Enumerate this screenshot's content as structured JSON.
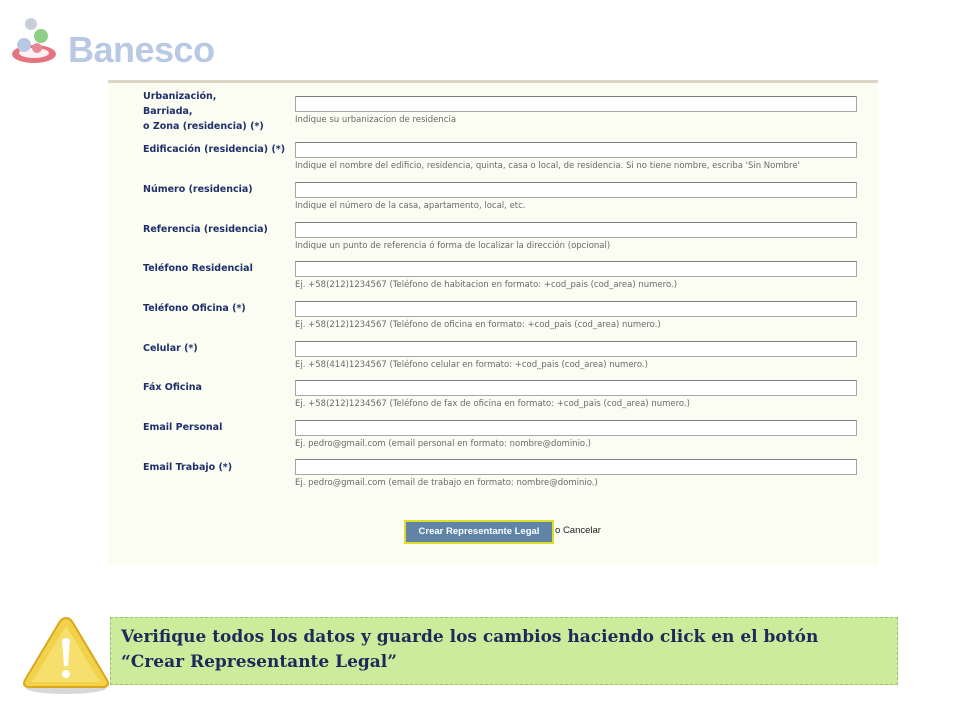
{
  "brand": {
    "name": "Banesco",
    "colors": {
      "logo_text": "#b9c9e4",
      "logo_red": "#e05b6a",
      "logo_green": "#8ecf86"
    }
  },
  "form": {
    "fields": [
      {
        "label": "Urbanización,\nBarriada,\no Zona (residencia) (*)",
        "value": "",
        "hint": "Indique su urbanizacion de residencia"
      },
      {
        "label": "Edificación (residencia) (*)",
        "value": "",
        "hint": "Indique el nombre del edificio, residencia, quinta, casa o local, de residencia. Si no tiene nombre, escriba 'Sin Nombre'"
      },
      {
        "label": "Número (residencia)",
        "value": "",
        "hint": "Indique el número de la casa, apartamento, local, etc."
      },
      {
        "label": "Referencia (residencia)",
        "value": "",
        "hint": "Indique un punto de referencia ó forma de localizar la dirección (opcional)"
      },
      {
        "label": "Teléfono Residencial",
        "value": "",
        "hint": "Ej. +58(212)1234567 (Teléfono de habitacion en formato: +cod_pais (cod_area) numero.)"
      },
      {
        "label": "Teléfono Oficina (*)",
        "value": "",
        "hint": "Ej. +58(212)1234567 (Teléfono de oficina en formato: +cod_pais (cod_area) numero.)"
      },
      {
        "label": "Celular (*)",
        "value": "",
        "hint": "Ej. +58(414)1234567 (Teléfono celular en formato: +cod_pais (cod_area) numero.)"
      },
      {
        "label": "Fáx Oficina",
        "value": "",
        "hint": "Ej. +58(212)1234567 (Teléfono de fax de oficina en formato: +cod_pais (cod_area) numero.)"
      },
      {
        "label": "Email Personal",
        "value": "",
        "hint": "Ej. pedro@gmail.com (email personal en formato: nombre@dominio.)"
      },
      {
        "label": "Email Trabajo (*)",
        "value": "",
        "hint": "Ej. pedro@gmail.com (email de trabajo en formato: nombre@dominio.)"
      }
    ],
    "submit_label": "Crear Representante Legal",
    "or_text": "o",
    "cancel_label": "Cancelar"
  },
  "notice": {
    "icon": "warning-icon",
    "text": "Verifique todos los datos y guarde los cambios haciendo click en el botón “Crear Representante Legal”"
  }
}
